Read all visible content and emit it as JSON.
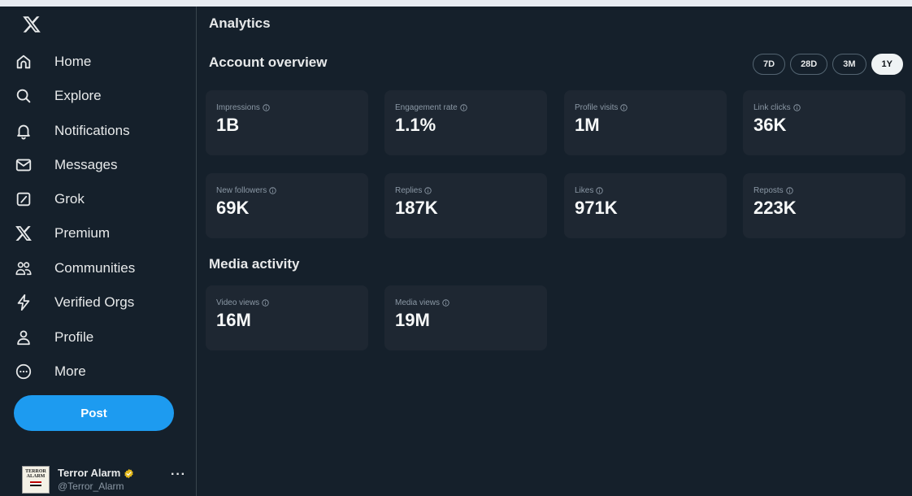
{
  "sidebar": {
    "nav": [
      {
        "label": "Home",
        "icon": "home-icon"
      },
      {
        "label": "Explore",
        "icon": "search-icon"
      },
      {
        "label": "Notifications",
        "icon": "bell-icon"
      },
      {
        "label": "Messages",
        "icon": "envelope-icon"
      },
      {
        "label": "Grok",
        "icon": "grok-icon"
      },
      {
        "label": "Premium",
        "icon": "x-logo-icon"
      },
      {
        "label": "Communities",
        "icon": "people-icon"
      },
      {
        "label": "Verified Orgs",
        "icon": "lightning-icon"
      },
      {
        "label": "Profile",
        "icon": "person-icon"
      },
      {
        "label": "More",
        "icon": "more-circle-icon"
      }
    ],
    "post_label": "Post",
    "account": {
      "name": "Terror Alarm",
      "handle": "@Terror_Alarm",
      "avatar_text": "TERROR ALARM"
    }
  },
  "main": {
    "title": "Analytics",
    "account_overview_title": "Account overview",
    "ranges": [
      {
        "label": "7D",
        "active": false
      },
      {
        "label": "28D",
        "active": false
      },
      {
        "label": "3M",
        "active": false
      },
      {
        "label": "1Y",
        "active": true
      }
    ],
    "overview_cards": [
      {
        "label": "Impressions",
        "value": "1B"
      },
      {
        "label": "Engagement rate",
        "value": "1.1%"
      },
      {
        "label": "Profile visits",
        "value": "1M"
      },
      {
        "label": "Link clicks",
        "value": "36K"
      },
      {
        "label": "New followers",
        "value": "69K"
      },
      {
        "label": "Replies",
        "value": "187K"
      },
      {
        "label": "Likes",
        "value": "971K"
      },
      {
        "label": "Reposts",
        "value": "223K"
      }
    ],
    "media_title": "Media activity",
    "media_cards": [
      {
        "label": "Video views",
        "value": "16M"
      },
      {
        "label": "Media views",
        "value": "19M"
      }
    ]
  },
  "colors": {
    "background": "#15202b",
    "card": "#1e2732",
    "accent": "#1d9bf0",
    "verified_gold": "#e2b719"
  }
}
